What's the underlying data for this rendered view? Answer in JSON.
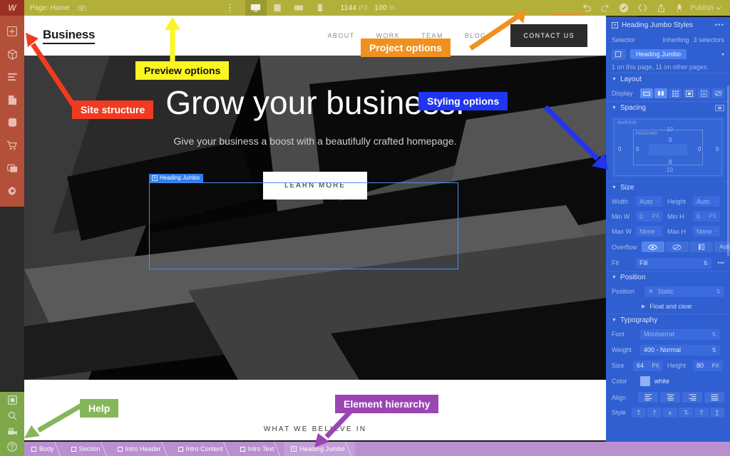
{
  "app": {
    "logo": "W"
  },
  "topbar": {
    "page_label": "Page: Home",
    "eye_icon": "eye-icon",
    "menu_icon": "vertical-dots-icon",
    "devices": [
      {
        "name": "desktop",
        "icon": "desktop-icon",
        "active": true
      },
      {
        "name": "tablet",
        "icon": "tablet-icon",
        "active": false
      },
      {
        "name": "tablet-landscape",
        "icon": "tablet-landscape-icon",
        "active": false
      },
      {
        "name": "mobile",
        "icon": "mobile-icon",
        "active": false
      }
    ],
    "width_value": "1144",
    "width_unit": "PX",
    "zoom_value": "100",
    "zoom_unit": "%",
    "actions": [
      {
        "name": "undo",
        "icon": "undo-icon"
      },
      {
        "name": "redo",
        "icon": "redo-icon"
      },
      {
        "name": "saved",
        "icon": "check-circle-icon"
      },
      {
        "name": "code",
        "icon": "code-brackets-icon"
      },
      {
        "name": "export",
        "icon": "export-icon"
      },
      {
        "name": "rocket",
        "icon": "rocket-icon"
      }
    ],
    "publish_label": "Publish"
  },
  "left_sidebar": {
    "tools": [
      {
        "name": "add-elements",
        "icon": "plus-icon"
      },
      {
        "name": "symbols",
        "icon": "cube-icon"
      },
      {
        "name": "navigator",
        "icon": "layers-icon"
      },
      {
        "name": "pages",
        "icon": "page-icon"
      },
      {
        "name": "cms",
        "icon": "database-icon"
      },
      {
        "name": "ecommerce",
        "icon": "cart-icon"
      },
      {
        "name": "assets",
        "icon": "media-icon"
      },
      {
        "name": "settings",
        "icon": "gear-icon"
      }
    ],
    "help_tools": [
      {
        "name": "preview-screen",
        "icon": "screen-icon"
      },
      {
        "name": "search",
        "icon": "search-icon"
      },
      {
        "name": "video-tutorials",
        "icon": "video-camera-icon"
      },
      {
        "name": "help",
        "icon": "question-mark-icon"
      }
    ]
  },
  "right_panel": {
    "tabs": [
      {
        "name": "style",
        "icon": "paintbrush-icon",
        "active": true
      },
      {
        "name": "settings",
        "icon": "gear-icon",
        "active": false
      },
      {
        "name": "interactions",
        "icon": "interactions-icon",
        "active": false
      },
      {
        "name": "effects",
        "icon": "lightning-icon",
        "active": false
      }
    ],
    "title": "Heading Jumbo Styles",
    "title_icon": "text-element-icon",
    "more_icon": "ellipsis-icon",
    "selector_label": "Selector",
    "inheriting_text": "Inheriting",
    "inheriting_count": "3 selectors",
    "selector_value": "Heading Jumbo",
    "usage_text": "1 on this page, 11 on other pages.",
    "sections": {
      "layout": {
        "title": "Layout",
        "display_label": "Display",
        "display_options": [
          "block",
          "flex",
          "grid",
          "inline-block",
          "inline",
          "none"
        ]
      },
      "spacing": {
        "title": "Spacing",
        "margin_label": "MARGIN",
        "padding_label": "PADDING",
        "margin": {
          "top": "10",
          "right": "0",
          "bottom": "10",
          "left": "0"
        },
        "padding": {
          "top": "0",
          "right": "0",
          "bottom": "0",
          "left": "0"
        }
      },
      "size": {
        "title": "Size",
        "width_label": "Width",
        "width_value": "Auto",
        "height_label": "Height",
        "height_value": "Auto",
        "minw_label": "Min W",
        "minw_value": "0",
        "minw_unit": "PX",
        "minh_label": "Min H",
        "minh_value": "0",
        "minh_unit": "PX",
        "maxw_label": "Max W",
        "maxw_value": "None",
        "maxh_label": "Max H",
        "maxh_value": "None",
        "overflow_label": "Overflow",
        "overflow_options": [
          "visible",
          "hidden",
          "scroll",
          "Auto"
        ],
        "fit_label": "Fit",
        "fit_value": "Fill"
      },
      "position": {
        "title": "Position",
        "position_label": "Position",
        "position_value": "Static",
        "float_label": "Float and clear"
      },
      "typography": {
        "title": "Typography",
        "font_label": "Font",
        "font_value": "Montserrat",
        "weight_label": "Weight",
        "weight_value": "400 - Normal",
        "size_label": "Size",
        "size_value": "64",
        "size_unit": "PX",
        "lineheight_label": "Height",
        "lineheight_value": "80",
        "lineheight_unit": "PX",
        "color_label": "Color",
        "color_value": "white",
        "color_hex": "#8fb0f5",
        "align_label": "Align",
        "style_label": "Style"
      }
    }
  },
  "canvas": {
    "logo": "Business",
    "nav_links": [
      "ABOUT",
      "WORK",
      "TEAM",
      "BLOG"
    ],
    "contact_button": "CONTACT US",
    "selection_tag": "Heading Jumbo",
    "heading": "Grow your business.",
    "subheading": "Give your business a boost with a beautifully crafted homepage.",
    "cta_button": "LEARN MORE",
    "section_title": "WHAT WE BELIEVE IN"
  },
  "breadcrumb": {
    "items": [
      {
        "label": "Body",
        "icon": "body-icon",
        "active": false
      },
      {
        "label": "Section",
        "icon": "box-icon",
        "active": false
      },
      {
        "label": "Intro Header",
        "icon": "box-icon",
        "active": false
      },
      {
        "label": "Intro Content",
        "icon": "box-icon",
        "active": false
      },
      {
        "label": "Intro Text",
        "icon": "box-icon",
        "active": false
      },
      {
        "label": "Heading Jumbo",
        "icon": "text-icon",
        "active": true
      }
    ]
  },
  "annotations": [
    {
      "name": "preview-options",
      "label": "Preview options",
      "color": "#fbf622"
    },
    {
      "name": "project-options",
      "label": "Project options",
      "color": "#f0911e"
    },
    {
      "name": "site-structure",
      "label": "Site structure",
      "color": "#f03b21"
    },
    {
      "name": "styling-options",
      "label": "Styling options",
      "color": "#1f35f0"
    },
    {
      "name": "help",
      "label": "Help",
      "color": "#86b65a"
    },
    {
      "name": "element-hierarchy",
      "label": "Element hierarchy",
      "color": "#9b45b5"
    }
  ]
}
